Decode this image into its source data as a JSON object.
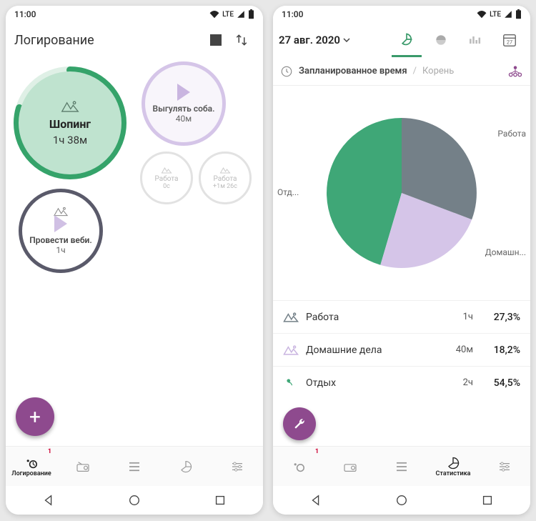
{
  "status": {
    "time": "11:00",
    "net": "LTE"
  },
  "left": {
    "title": "Логирование",
    "main": {
      "label": "Шопинг",
      "time": "1ч 38м"
    },
    "dog": {
      "label": "Выгулять соба.",
      "time": "40м"
    },
    "web": {
      "label": "Провести веби.",
      "time": "1ч"
    },
    "sm1": {
      "label": "Работа",
      "time": "0с"
    },
    "sm2": {
      "label": "Работа",
      "time": "+1м 26с"
    },
    "nav": {
      "logging": "Логирование",
      "badge": "1"
    }
  },
  "right": {
    "date": "27 авг. 2020",
    "calday": "27",
    "header": {
      "planned": "Запланированное время",
      "root": "Корень"
    },
    "pie_labels": {
      "work": "Работа",
      "home": "Домашн...",
      "rest": "Отд..."
    },
    "legend": {
      "work": {
        "name": "Работа",
        "dur": "1ч",
        "pct": "27,3%"
      },
      "home": {
        "name": "Домашние дела",
        "dur": "40м",
        "pct": "18,2%"
      },
      "rest": {
        "name": "Отдых",
        "dur": "2ч",
        "pct": "54,5%"
      }
    },
    "nav": {
      "stats": "Статистика",
      "badge": "1"
    }
  },
  "chart_data": {
    "type": "pie",
    "title": "Запланированное время",
    "series": [
      {
        "name": "Работа",
        "value": 27.3,
        "duration": "1ч",
        "color": "#748088"
      },
      {
        "name": "Домашние дела",
        "value": 18.2,
        "duration": "40м",
        "color": "#d5c5e8"
      },
      {
        "name": "Отдых",
        "value": 54.5,
        "duration": "2ч",
        "color": "#3fa777"
      }
    ]
  }
}
